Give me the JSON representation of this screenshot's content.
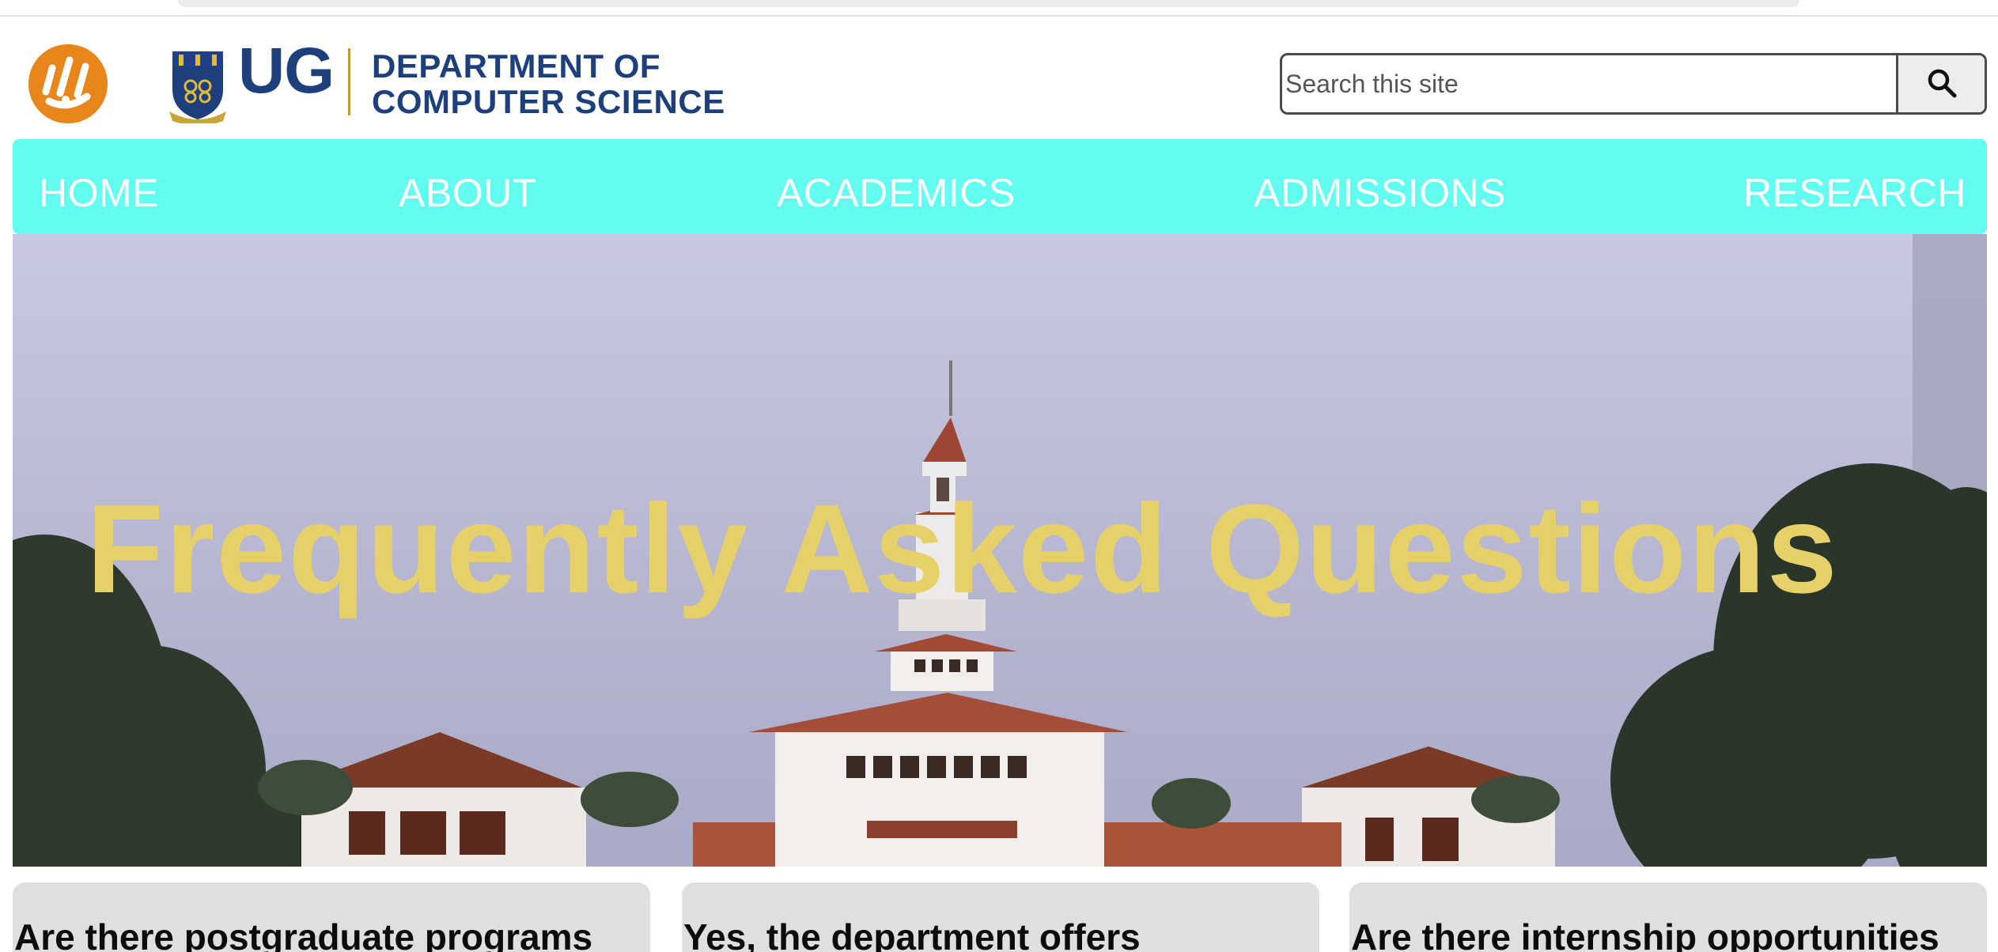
{
  "header": {
    "site_logo_icon": "orange-circle-logo-icon",
    "university_crest_icon": "ug-crest-icon",
    "university_abbr": "UG",
    "department_line1": "DEPARTMENT OF",
    "department_line2": "COMPUTER SCIENCE",
    "search": {
      "placeholder": "Search this site",
      "button_icon": "search-icon"
    }
  },
  "nav": {
    "items": [
      {
        "label": "HOME"
      },
      {
        "label": "ABOUT"
      },
      {
        "label": "ACADEMICS"
      },
      {
        "label": "ADMISSIONS"
      },
      {
        "label": "RESEARCH"
      }
    ]
  },
  "hero": {
    "title": "Frequently Asked Questions",
    "image": "university-great-hall-photo"
  },
  "faq_cards": [
    {
      "text": "Are there postgraduate programs"
    },
    {
      "text": "Yes, the department offers"
    },
    {
      "text": "Are there internship opportunities"
    }
  ],
  "colors": {
    "nav_background": "#62fcf0",
    "brand_blue": "#1d3f7c",
    "hero_title": "#e5d069",
    "logo_orange": "#e8861c",
    "card_background": "#dfdfdf"
  }
}
